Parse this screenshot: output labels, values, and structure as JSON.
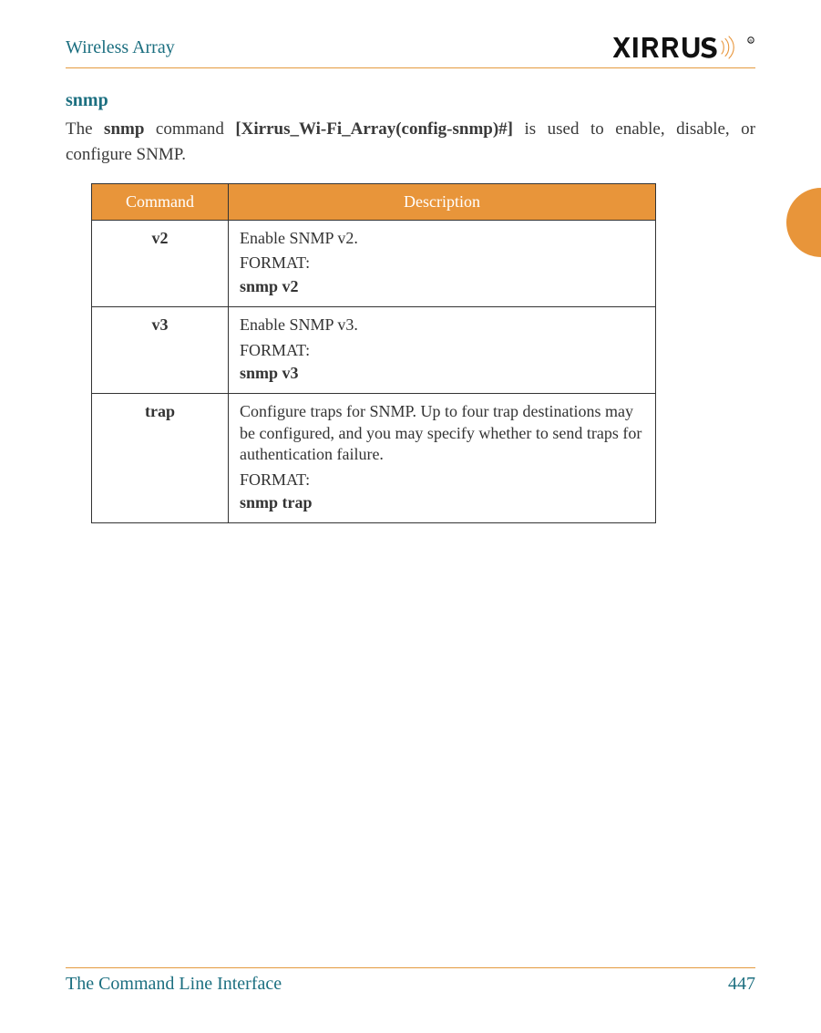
{
  "header": {
    "title": "Wireless Array",
    "logo_text": "XIRRUS"
  },
  "section": {
    "heading": "snmp",
    "intro_pre": "The ",
    "intro_cmd": "snmp",
    "intro_mid": " command ",
    "intro_prompt": "[Xirrus_Wi-Fi_Array(config-snmp)#]",
    "intro_post": " is used to enable, disable, or configure SNMP."
  },
  "table": {
    "headers": {
      "command": "Command",
      "description": "Description"
    },
    "rows": [
      {
        "command": "v2",
        "desc": "Enable SNMP v2.",
        "format_label": "FORMAT:",
        "format_value": "snmp v2"
      },
      {
        "command": "v3",
        "desc": "Enable SNMP v3.",
        "format_label": "FORMAT:",
        "format_value": "snmp v3"
      },
      {
        "command": "trap",
        "desc": "Configure traps for SNMP. Up to four trap destinations may be configured, and you may specify whether to send traps for authentication failure.",
        "format_label": "FORMAT:",
        "format_value": "snmp trap"
      }
    ]
  },
  "footer": {
    "section_title": "The Command Line Interface",
    "page_number": "447"
  }
}
